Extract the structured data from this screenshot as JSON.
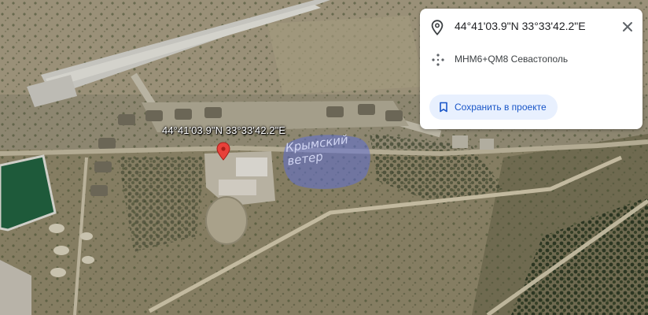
{
  "map": {
    "pin_label": "44°41'03.9\"N 33°33'42.2\"E",
    "watermark_lines": [
      "Крымский",
      "ветер"
    ],
    "marker_icon": "map-marker-icon",
    "colors": {
      "marker": "#e8413a",
      "reservoir": "#1e5a3a",
      "runway": "#c9c9c4",
      "watermark": "#5f6fd4"
    }
  },
  "info_card": {
    "coordinates": "44°41'03.9\"N 33°33'42.2\"E",
    "pin_icon": "location-pin-icon",
    "close_icon": "close-icon",
    "plus_code_icon": "plus-code-icon",
    "plus_code": "MHM6+QM8 Севастополь",
    "save_icon": "bookmark-icon",
    "save_label": "Сохранить в проекте",
    "colors": {
      "save_bg": "#e8f0fe",
      "save_text": "#1a56c8"
    }
  }
}
